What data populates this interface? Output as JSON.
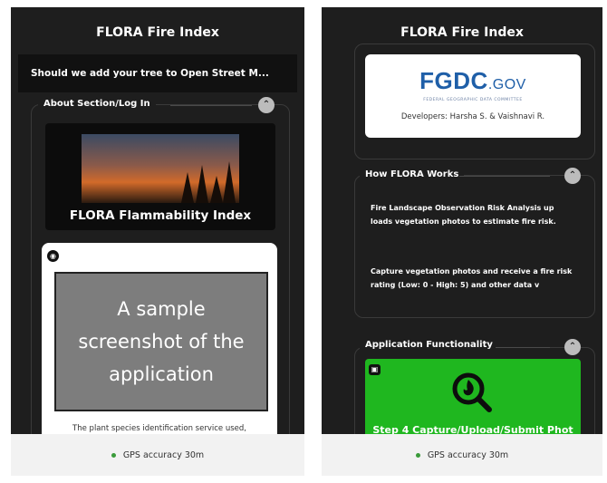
{
  "app_title": "FLORA Fire Index",
  "left_screen": {
    "notification": "Should we add your tree to Open Street M...",
    "about_section": {
      "title": "About Section/Log In",
      "banner_caption": "FLORA Flammability Index",
      "sample_card": {
        "placeholder_text": "A sample screenshot of the application",
        "body_text": "The plant species identification service used,"
      }
    }
  },
  "right_screen": {
    "fgdc_card": {
      "logo_main": "FGDC",
      "logo_suffix": ".GOV",
      "logo_tagline": "FEDERAL GEOGRAPHIC DATA COMMITTEE",
      "developers": "Developers: Harsha S. & Vaishnavi R."
    },
    "how_section": {
      "title": "How FLORA Works",
      "paragraph_1": "Fire Landscape Observation Risk Analysis up loads vegetation photos to estimate fire risk.",
      "paragraph_2": "Capture vegetation photos and receive a fire risk rating (Low: 0 - High: 5) and other data v"
    },
    "functionality_section": {
      "title": "Application Functionality",
      "step_label": "Step 4 Capture/Upload/Submit Phot"
    }
  },
  "gps_status": "GPS accuracy 30m",
  "icons": {
    "collapse": "chevron-up-icon",
    "card_badge": "eye-icon",
    "camera_badge": "camera-icon",
    "search_flame": "search-flame-icon"
  },
  "colors": {
    "background": "#1e1e1e",
    "accent_green": "#1fb71f",
    "gps_dot": "#3a9b3a",
    "fgdc_blue": "#1f5fa8"
  }
}
